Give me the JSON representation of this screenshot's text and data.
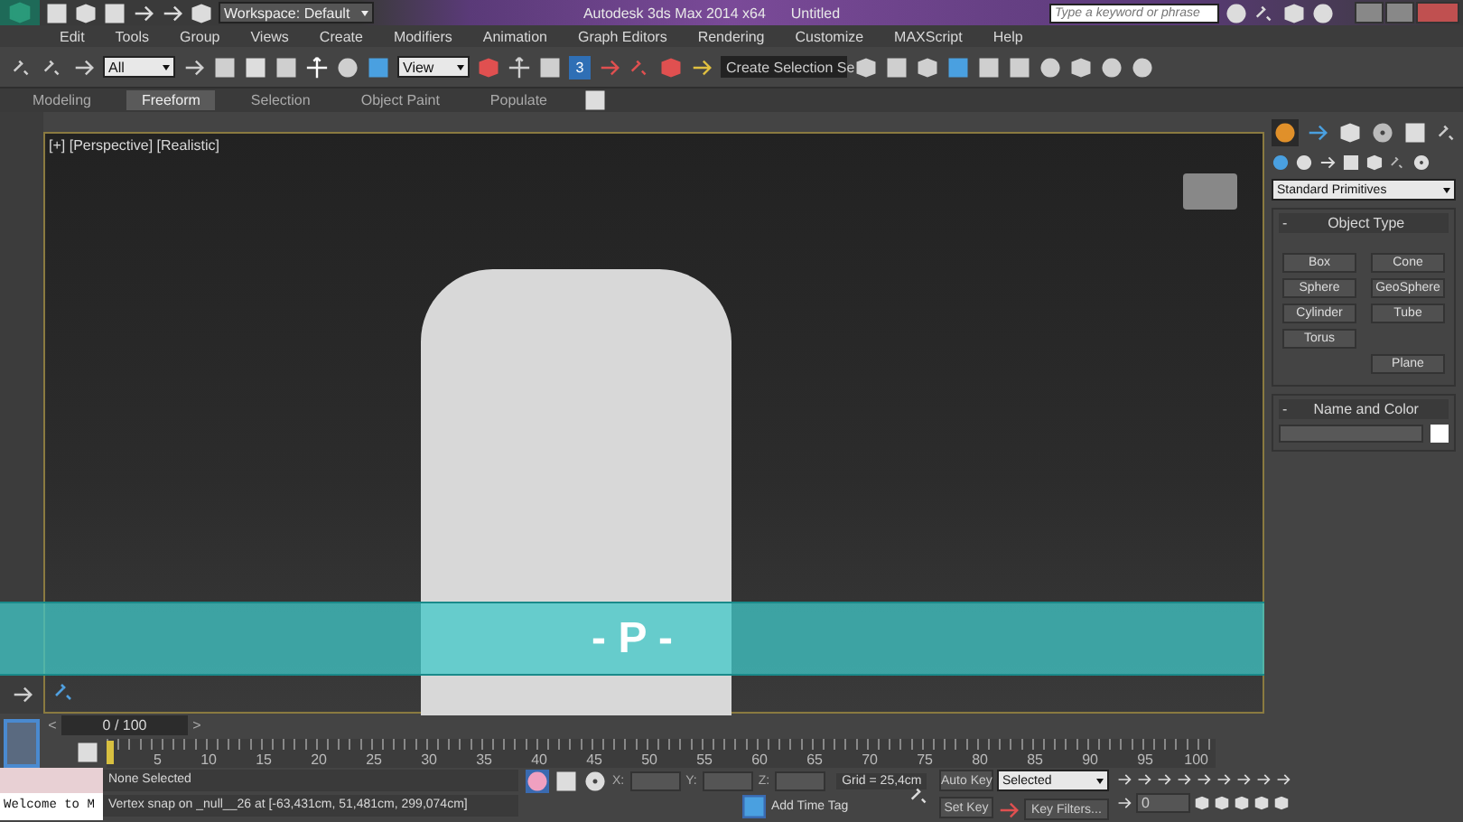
{
  "title_bar": {
    "workspace": "Workspace: Default",
    "title": "Autodesk 3ds Max 2014 x64",
    "document": "Untitled",
    "search": {
      "placeholder": "Type a keyword or phrase"
    }
  },
  "menu": [
    "Edit",
    "Tools",
    "Group",
    "Views",
    "Create",
    "Modifiers",
    "Animation",
    "Graph Editors",
    "Rendering",
    "Customize",
    "MAXScript",
    "Help"
  ],
  "toolbar": {
    "selection_filter": "All",
    "reference_coord": "View",
    "snap_value": "3",
    "selection_set": "Create Selection Se"
  },
  "ribbon_tabs": [
    {
      "label": "Modeling",
      "selected": false
    },
    {
      "label": "Freeform",
      "selected": true
    },
    {
      "label": "Selection",
      "selected": false
    },
    {
      "label": "Object Paint",
      "selected": false
    },
    {
      "label": "Populate",
      "selected": false
    }
  ],
  "viewport": {
    "label": "[+] [Perspective] [Realistic]",
    "caption": "- P -"
  },
  "command_panel": {
    "dropdown": "Standard Primitives",
    "object_type": {
      "collapse": "-",
      "title": "Object Type",
      "rows": [
        {
          "left": "Box",
          "right": "Cone"
        },
        {
          "left": "Sphere",
          "right": "GeoSphere"
        },
        {
          "left": "Cylinder",
          "right": "Tube"
        },
        {
          "left": "Torus"
        },
        {
          "right": "Plane"
        }
      ]
    },
    "name_and_color": {
      "collapse": "-",
      "title": "Name and Color"
    }
  },
  "time_slider": {
    "previous": "<",
    "label": "0 / 100",
    "next": ">"
  },
  "track_ticks": [
    "5",
    "10",
    "15",
    "20",
    "25",
    "30",
    "35",
    "40",
    "45",
    "50",
    "55",
    "60",
    "65",
    "70",
    "75",
    "80",
    "85",
    "90",
    "95",
    "100"
  ],
  "status": {
    "listener_output": "Welcome to M",
    "selection": "None Selected",
    "prompt": "Vertex snap on _null__26 at [-63,431cm, 51,481cm, 299,074cm]",
    "x_label": "X:",
    "y_label": "Y:",
    "z_label": "Z:",
    "grid": "Grid = 25,4cm",
    "add_time_tag": "Add Time Tag",
    "auto_key": "Auto Key",
    "set_key": "Set Key",
    "key_mode": "Selected",
    "key_filters": "Key Filters...",
    "frame": "0"
  }
}
